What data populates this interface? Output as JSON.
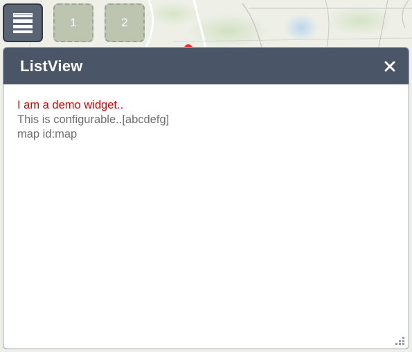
{
  "toolbar": {
    "tiles": [
      {
        "label": ""
      },
      {
        "label": "1"
      },
      {
        "label": "2"
      }
    ]
  },
  "panel": {
    "title": "ListView",
    "lines": [
      {
        "text": "I am a demo widget.."
      },
      {
        "text": "This is configurable..[abcdefg]"
      },
      {
        "text": "map id:map"
      }
    ]
  },
  "icons": {
    "list": "list-view-icon",
    "close": "close-icon",
    "resize": "resize-grip-icon"
  },
  "colors": {
    "header": "#4a5568",
    "highlight_text": "#e00000",
    "body_text": "#6f6f6f"
  }
}
